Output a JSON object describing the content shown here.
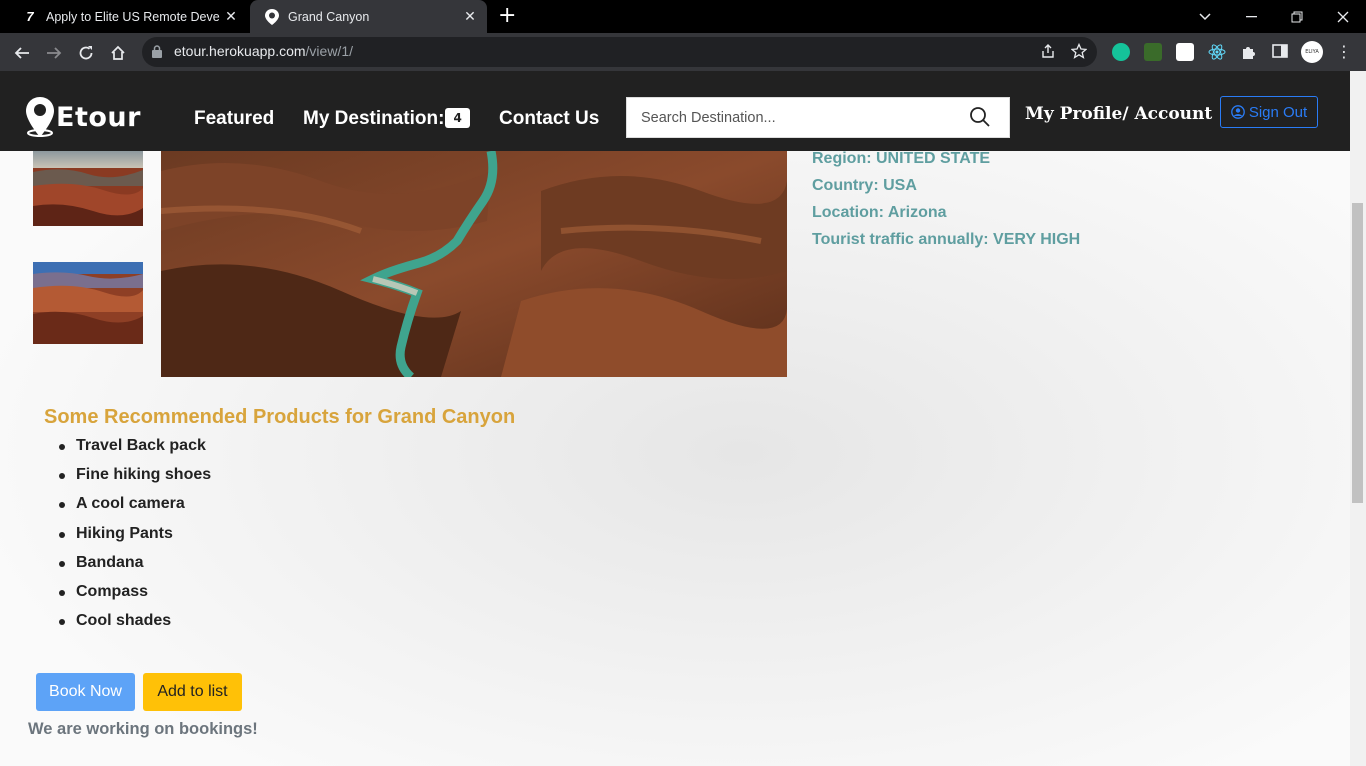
{
  "browser": {
    "tabs": [
      {
        "title": "Apply to Elite US Remote Develop",
        "favicon": "7",
        "active": false
      },
      {
        "title": "Grand Canyon",
        "favicon": "etour-pin",
        "active": true
      }
    ],
    "url_host": "etour.herokuapp.com",
    "url_path": "/view/1/",
    "profile_initials": "ELIYA"
  },
  "nav": {
    "brand": "Etour",
    "featured": "Featured",
    "my_destination": "My Destination:",
    "destination_count": "4",
    "contact": "Contact Us",
    "search_placeholder": "Search Destination...",
    "profile": "My Profile/ Account",
    "sign_out": "Sign Out"
  },
  "details": {
    "region": "Region: UNITED STATE",
    "country": "Country: USA",
    "location": "Location: Arizona",
    "traffic": "Tourist traffic annually: VERY HIGH"
  },
  "recommended": {
    "title": "Some Recommended Products for Grand Canyon",
    "items": [
      "Travel Back pack",
      "Fine hiking shoes",
      "A cool camera",
      "Hiking Pants",
      "Bandana",
      "Compass",
      "Cool shades"
    ]
  },
  "actions": {
    "book": "Book Now",
    "add": "Add to list",
    "note": "We are working on bookings!"
  },
  "colors": {
    "navbar": "#212121",
    "detail_text": "#5f9ea0",
    "rec_title": "#d8a43c",
    "book_btn": "#5da3f7",
    "add_btn": "#ffc107",
    "sign_out": "#2a7cf6"
  }
}
